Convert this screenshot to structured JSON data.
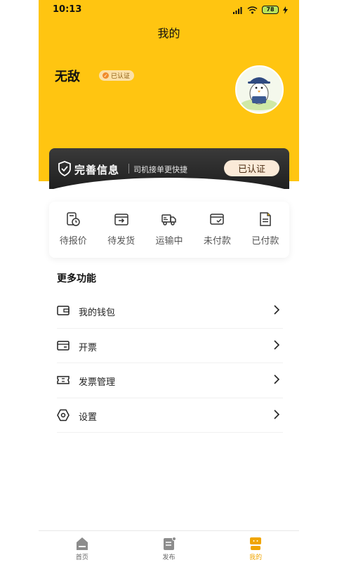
{
  "status_bar": {
    "time": "10:13",
    "battery": "78"
  },
  "nav": {
    "title": "我的"
  },
  "profile": {
    "name": "无敌",
    "verify_badge": "已认证"
  },
  "promo": {
    "title": "完善信息",
    "subtitle": "司机接单更快捷",
    "button": "已认证"
  },
  "orders": [
    {
      "label": "待报价",
      "icon": "pending-quote-icon"
    },
    {
      "label": "待发货",
      "icon": "pending-ship-icon"
    },
    {
      "label": "运输中",
      "icon": "truck-icon"
    },
    {
      "label": "未付款",
      "icon": "unpaid-card-icon"
    },
    {
      "label": "已付款",
      "icon": "paid-doc-icon"
    }
  ],
  "more": {
    "title": "更多功能",
    "items": [
      {
        "label": "我的钱包",
        "icon": "wallet-icon"
      },
      {
        "label": "开票",
        "icon": "invoice-card-icon"
      },
      {
        "label": "发票管理",
        "icon": "ticket-icon"
      },
      {
        "label": "设置",
        "icon": "hexagon-settings-icon"
      }
    ]
  },
  "tabbar": [
    {
      "label": "首页",
      "icon": "home-icon"
    },
    {
      "label": "发布",
      "icon": "publish-icon"
    },
    {
      "label": "我的",
      "icon": "profile-icon",
      "active": true
    }
  ],
  "colors": {
    "brand_yellow": "#FFC511",
    "active_tab": "#F0A500",
    "dark_card": "#2B2B2B"
  }
}
